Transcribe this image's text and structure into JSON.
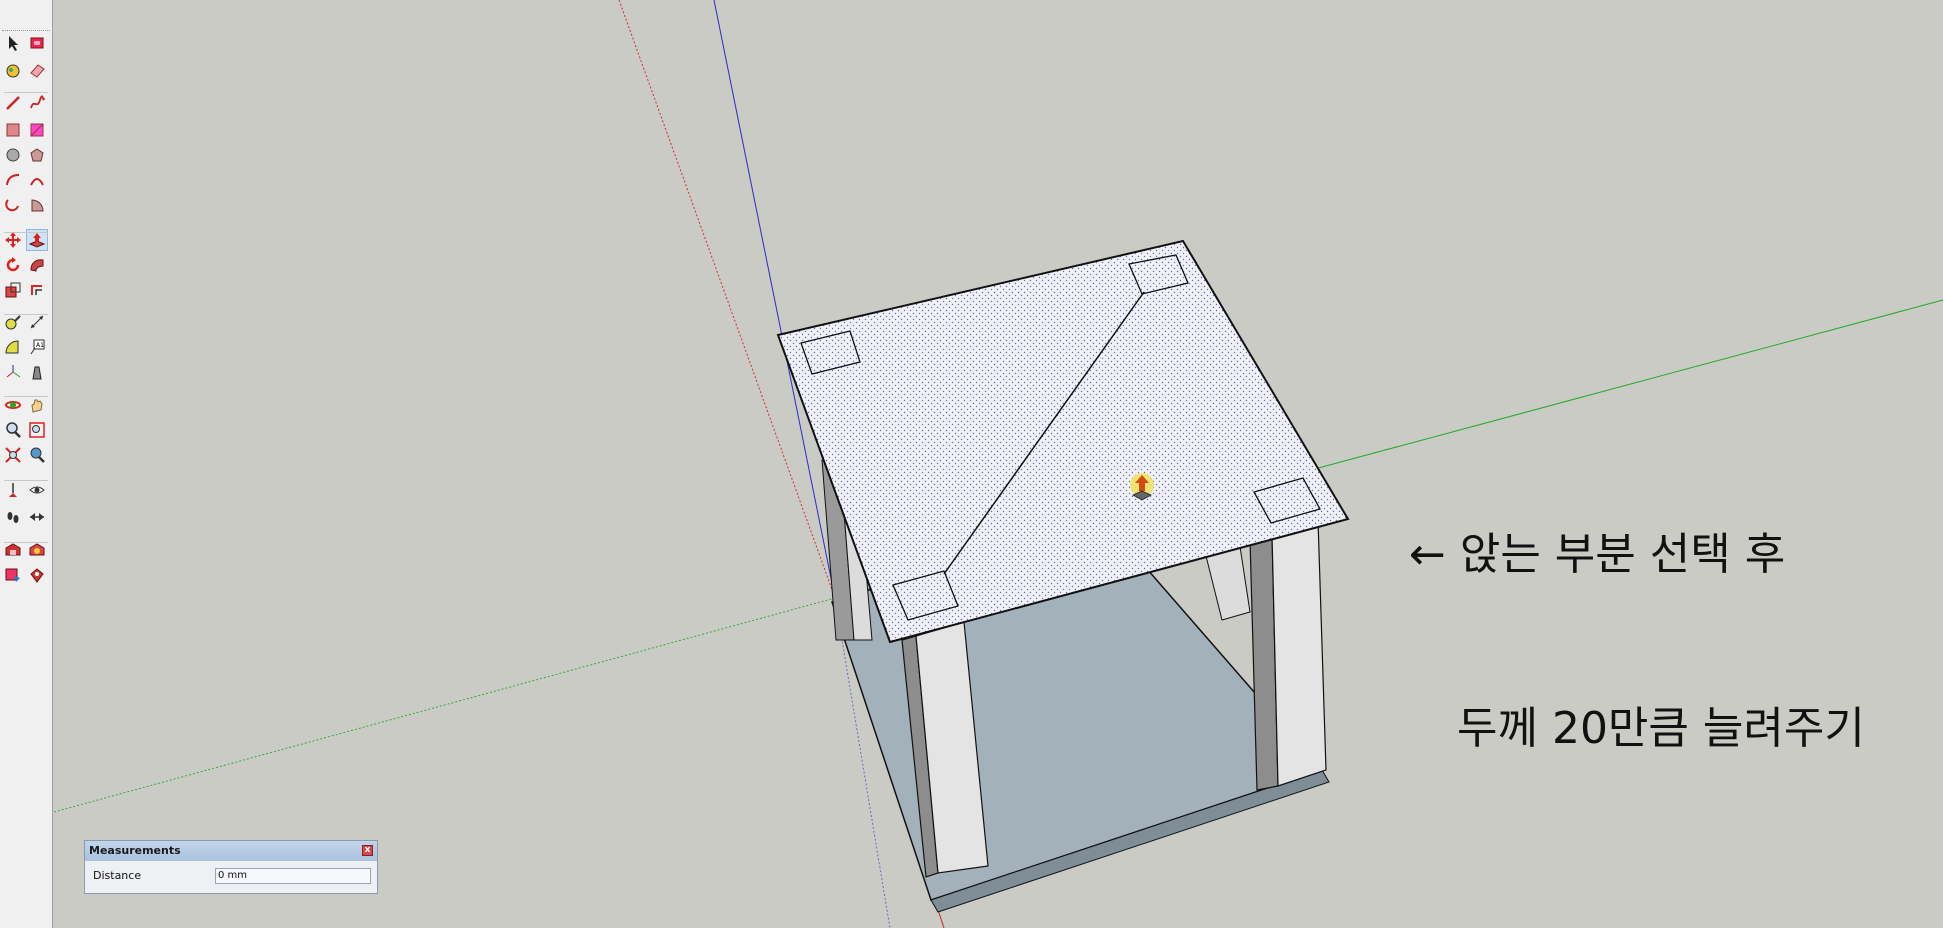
{
  "toolbar": {
    "tools": [
      {
        "name": "select-tool",
        "icon": "arrow-icon"
      },
      {
        "name": "make-component-tool",
        "icon": "component-icon"
      },
      {
        "name": "paint-bucket-tool",
        "icon": "paint-bucket-icon"
      },
      {
        "name": "eraser-tool",
        "icon": "eraser-icon"
      },
      {
        "name": "line-tool",
        "icon": "pencil-icon"
      },
      {
        "name": "freehand-tool",
        "icon": "freehand-icon"
      },
      {
        "name": "rectangle-tool",
        "icon": "rectangle-icon"
      },
      {
        "name": "rotated-rectangle-tool",
        "icon": "rotated-rectangle-icon"
      },
      {
        "name": "circle-tool",
        "icon": "circle-icon"
      },
      {
        "name": "polygon-tool",
        "icon": "polygon-icon"
      },
      {
        "name": "arc-tool",
        "icon": "arc-icon"
      },
      {
        "name": "two-point-arc-tool",
        "icon": "two-point-arc-icon"
      },
      {
        "name": "three-point-arc-tool",
        "icon": "three-point-arc-icon"
      },
      {
        "name": "pie-tool",
        "icon": "pie-icon"
      },
      {
        "name": "move-tool",
        "icon": "move-icon"
      },
      {
        "name": "push-pull-tool",
        "icon": "push-pull-icon",
        "active": true
      },
      {
        "name": "rotate-tool",
        "icon": "rotate-icon"
      },
      {
        "name": "follow-me-tool",
        "icon": "follow-me-icon"
      },
      {
        "name": "scale-tool",
        "icon": "scale-icon"
      },
      {
        "name": "offset-tool",
        "icon": "offset-icon"
      },
      {
        "name": "tape-measure-tool",
        "icon": "tape-measure-icon"
      },
      {
        "name": "dimension-tool",
        "icon": "dimension-icon"
      },
      {
        "name": "protractor-tool",
        "icon": "protractor-icon"
      },
      {
        "name": "text-tool",
        "icon": "text-icon"
      },
      {
        "name": "axes-tool",
        "icon": "axes-icon"
      },
      {
        "name": "3d-text-tool",
        "icon": "3d-text-icon"
      },
      {
        "name": "orbit-tool",
        "icon": "orbit-icon"
      },
      {
        "name": "pan-tool",
        "icon": "hand-icon"
      },
      {
        "name": "zoom-tool",
        "icon": "magnifier-icon"
      },
      {
        "name": "zoom-window-tool",
        "icon": "zoom-window-icon"
      },
      {
        "name": "zoom-extents-tool",
        "icon": "zoom-extents-icon"
      },
      {
        "name": "previous-view-tool",
        "icon": "previous-view-icon"
      },
      {
        "name": "position-camera-tool",
        "icon": "position-camera-icon"
      },
      {
        "name": "look-around-tool",
        "icon": "eye-icon"
      },
      {
        "name": "walk-tool",
        "icon": "footprints-icon"
      },
      {
        "name": "section-plane-tool",
        "icon": "section-plane-icon"
      },
      {
        "name": "3d-warehouse-tool",
        "icon": "warehouse-icon"
      },
      {
        "name": "extension-warehouse-tool",
        "icon": "extension-warehouse-icon"
      },
      {
        "name": "share-model-tool",
        "icon": "share-model-icon"
      },
      {
        "name": "get-models-tool",
        "icon": "get-models-icon"
      }
    ]
  },
  "annotation": {
    "line1": "← 앉는 부분 선택 후",
    "line2": "두께 20만큼 늘려주기"
  },
  "measurements": {
    "title": "Measurements",
    "close_label": "x",
    "label": "Distance",
    "value": "0 mm"
  },
  "colors": {
    "background": "#cbcbc6",
    "red_axis": "#cc2222",
    "green_axis": "#22aa22",
    "blue_axis": "#2222cc",
    "seat_face": "#eeeef8",
    "floor_face": "#a3b1ba",
    "leg_face": "#e4e4e4"
  }
}
